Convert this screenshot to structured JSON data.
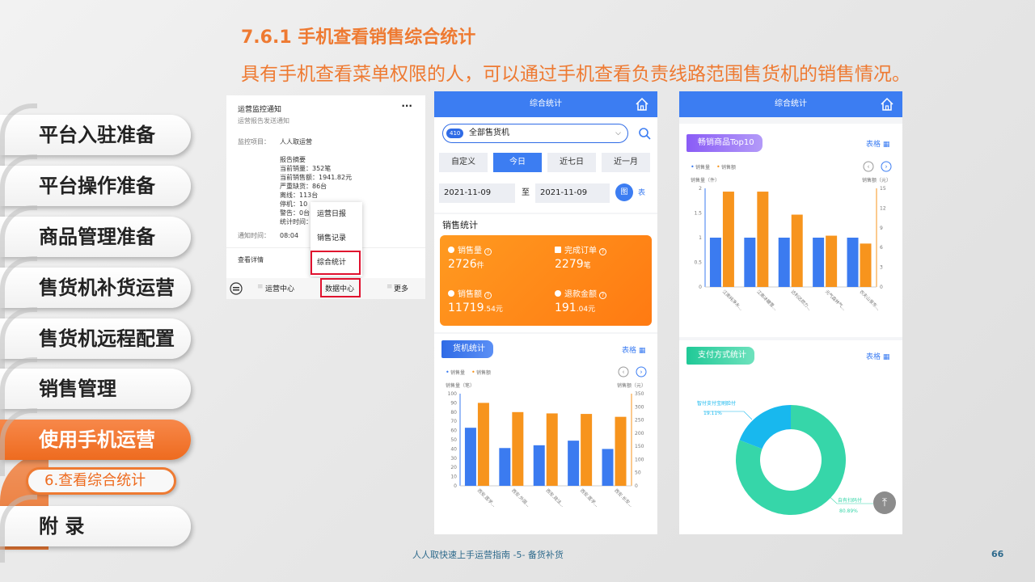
{
  "slide": {
    "heading": "7.6.1 手机查看销售综合统计",
    "subheading": "具有手机查看菜单权限的人，可以通过手机查看负责线路范围售货机的销售情况。",
    "footer_text": "人人取快速上手运营指南 -5- 备货补货",
    "page_number": "66",
    "accent_color": "#ee7a32"
  },
  "nav": {
    "items": [
      {
        "label": "平台入驻准备"
      },
      {
        "label": "平台操作准备"
      },
      {
        "label": "商品管理准备"
      },
      {
        "label": "售货机补货运营"
      },
      {
        "label": "售货机远程配置"
      },
      {
        "label": "销售管理"
      },
      {
        "label": "使用手机运营"
      },
      {
        "label": "附 录"
      }
    ],
    "active_item": "使用手机运营",
    "sub_item": "6.查看综合统计"
  },
  "notification": {
    "title": "运营监控通知",
    "more_icon": "ellipsis-icon",
    "subtitle": "运营报告发送通知",
    "project_label": "监控项目：",
    "project_value": "人人取运营",
    "summary_lines": [
      "报告摘要",
      "当前销量：352笔",
      "当前销售额：1941.82元",
      "严重缺货：86台",
      "离线：113台",
      "停机：10",
      "警告：0台",
      "统计时间："
    ],
    "notify_time_label": "通知时间：",
    "notify_time_value": "08:04",
    "view_detail": "查看详情",
    "popup_menu": [
      "运营日报",
      "销售记录",
      "综合统计"
    ],
    "bottom_bar": [
      "运营中心",
      "数据中心",
      "更多"
    ],
    "keyboard_icon": "keyboard-icon"
  },
  "stats_screen": {
    "header_title": "综合统计",
    "machine_select": {
      "badge": "410",
      "value": "全部售货机"
    },
    "range_tabs": [
      "自定义",
      "今日",
      "近七日",
      "近一月"
    ],
    "active_tab": "今日",
    "date_from": "2021-11-09",
    "date_sep": "至",
    "date_to": "2021-11-09",
    "view_graph": "图",
    "view_table": "表",
    "sales_title": "销售统计",
    "kpis": [
      {
        "label": "销售量",
        "value": "2726",
        "unit": "件"
      },
      {
        "label": "完成订单",
        "value": "2279",
        "unit": "笔"
      },
      {
        "label": "销售额",
        "value": "11719",
        "decimal": ".54",
        "unit": "元"
      },
      {
        "label": "退款金额",
        "value": "191",
        "decimal": ".04",
        "unit": "元"
      }
    ],
    "machine_stats_title": "货机统计",
    "table_link": "表格"
  },
  "products_screen": {
    "header_title": "综合统计",
    "top_title": "畅销商品Top10",
    "table_link": "表格",
    "pay_title": "支付方式统计",
    "pay_table_link": "表格"
  },
  "chart_data": [
    {
      "type": "bar",
      "series": [
        {
          "name": "销售量",
          "values": [
            63,
            41,
            44,
            49,
            40
          ],
          "color": "#3b7bf0"
        },
        {
          "name": "销售额",
          "values": [
            315,
            280,
            275,
            273,
            262
          ],
          "color": "#f7941d"
        }
      ],
      "categories": [
        "西安.医学...",
        "西安.外国...",
        "西安.政法...",
        "西安.医学...",
        "西安.长安..."
      ],
      "ylabel": "销售量（笔）",
      "y2label": "销售额（元）",
      "ylim": [
        0,
        100
      ],
      "y2lim": [
        0,
        350
      ],
      "yticks": [
        "0",
        "10",
        "20",
        "30",
        "40",
        "50",
        "60",
        "70",
        "80",
        "90",
        "100"
      ],
      "y2ticks": [
        "0",
        "50",
        "100",
        "150",
        "200",
        "250",
        "300",
        "350"
      ],
      "legend": "top-left"
    },
    {
      "type": "bar",
      "series": [
        {
          "name": "销售量",
          "values": [
            1,
            1,
            1,
            1,
            1
          ],
          "color": "#3b7bf0"
        },
        {
          "name": "销售额",
          "values": [
            14.5,
            14.5,
            11.0,
            7.8,
            6.6
          ],
          "color": "#f7941d"
        }
      ],
      "categories": [
        "江南纯净水...",
        "江南冰糖雪...",
        "达利达燃力...",
        "元气森林气...",
        "农夫山泉东..."
      ],
      "ylabel": "销售量（件）",
      "y2label": "销售额（元）",
      "ylim": [
        0,
        2
      ],
      "y2lim": [
        0,
        15
      ],
      "yticks": [
        "0",
        "0.5",
        "1",
        "1.5",
        "2"
      ],
      "y2ticks": [
        "0",
        "3",
        "6",
        "9",
        "12",
        "15"
      ],
      "legend": "top-left"
    },
    {
      "type": "pie",
      "slices": [
        {
          "label": "自有扫码付",
          "pct": "80.89%",
          "value": 80.89,
          "color": "#36d6a9"
        },
        {
          "label": "智付支付宝刷脸付",
          "pct": "19.11%",
          "value": 19.11,
          "color": "#18b8ee"
        }
      ]
    }
  ]
}
